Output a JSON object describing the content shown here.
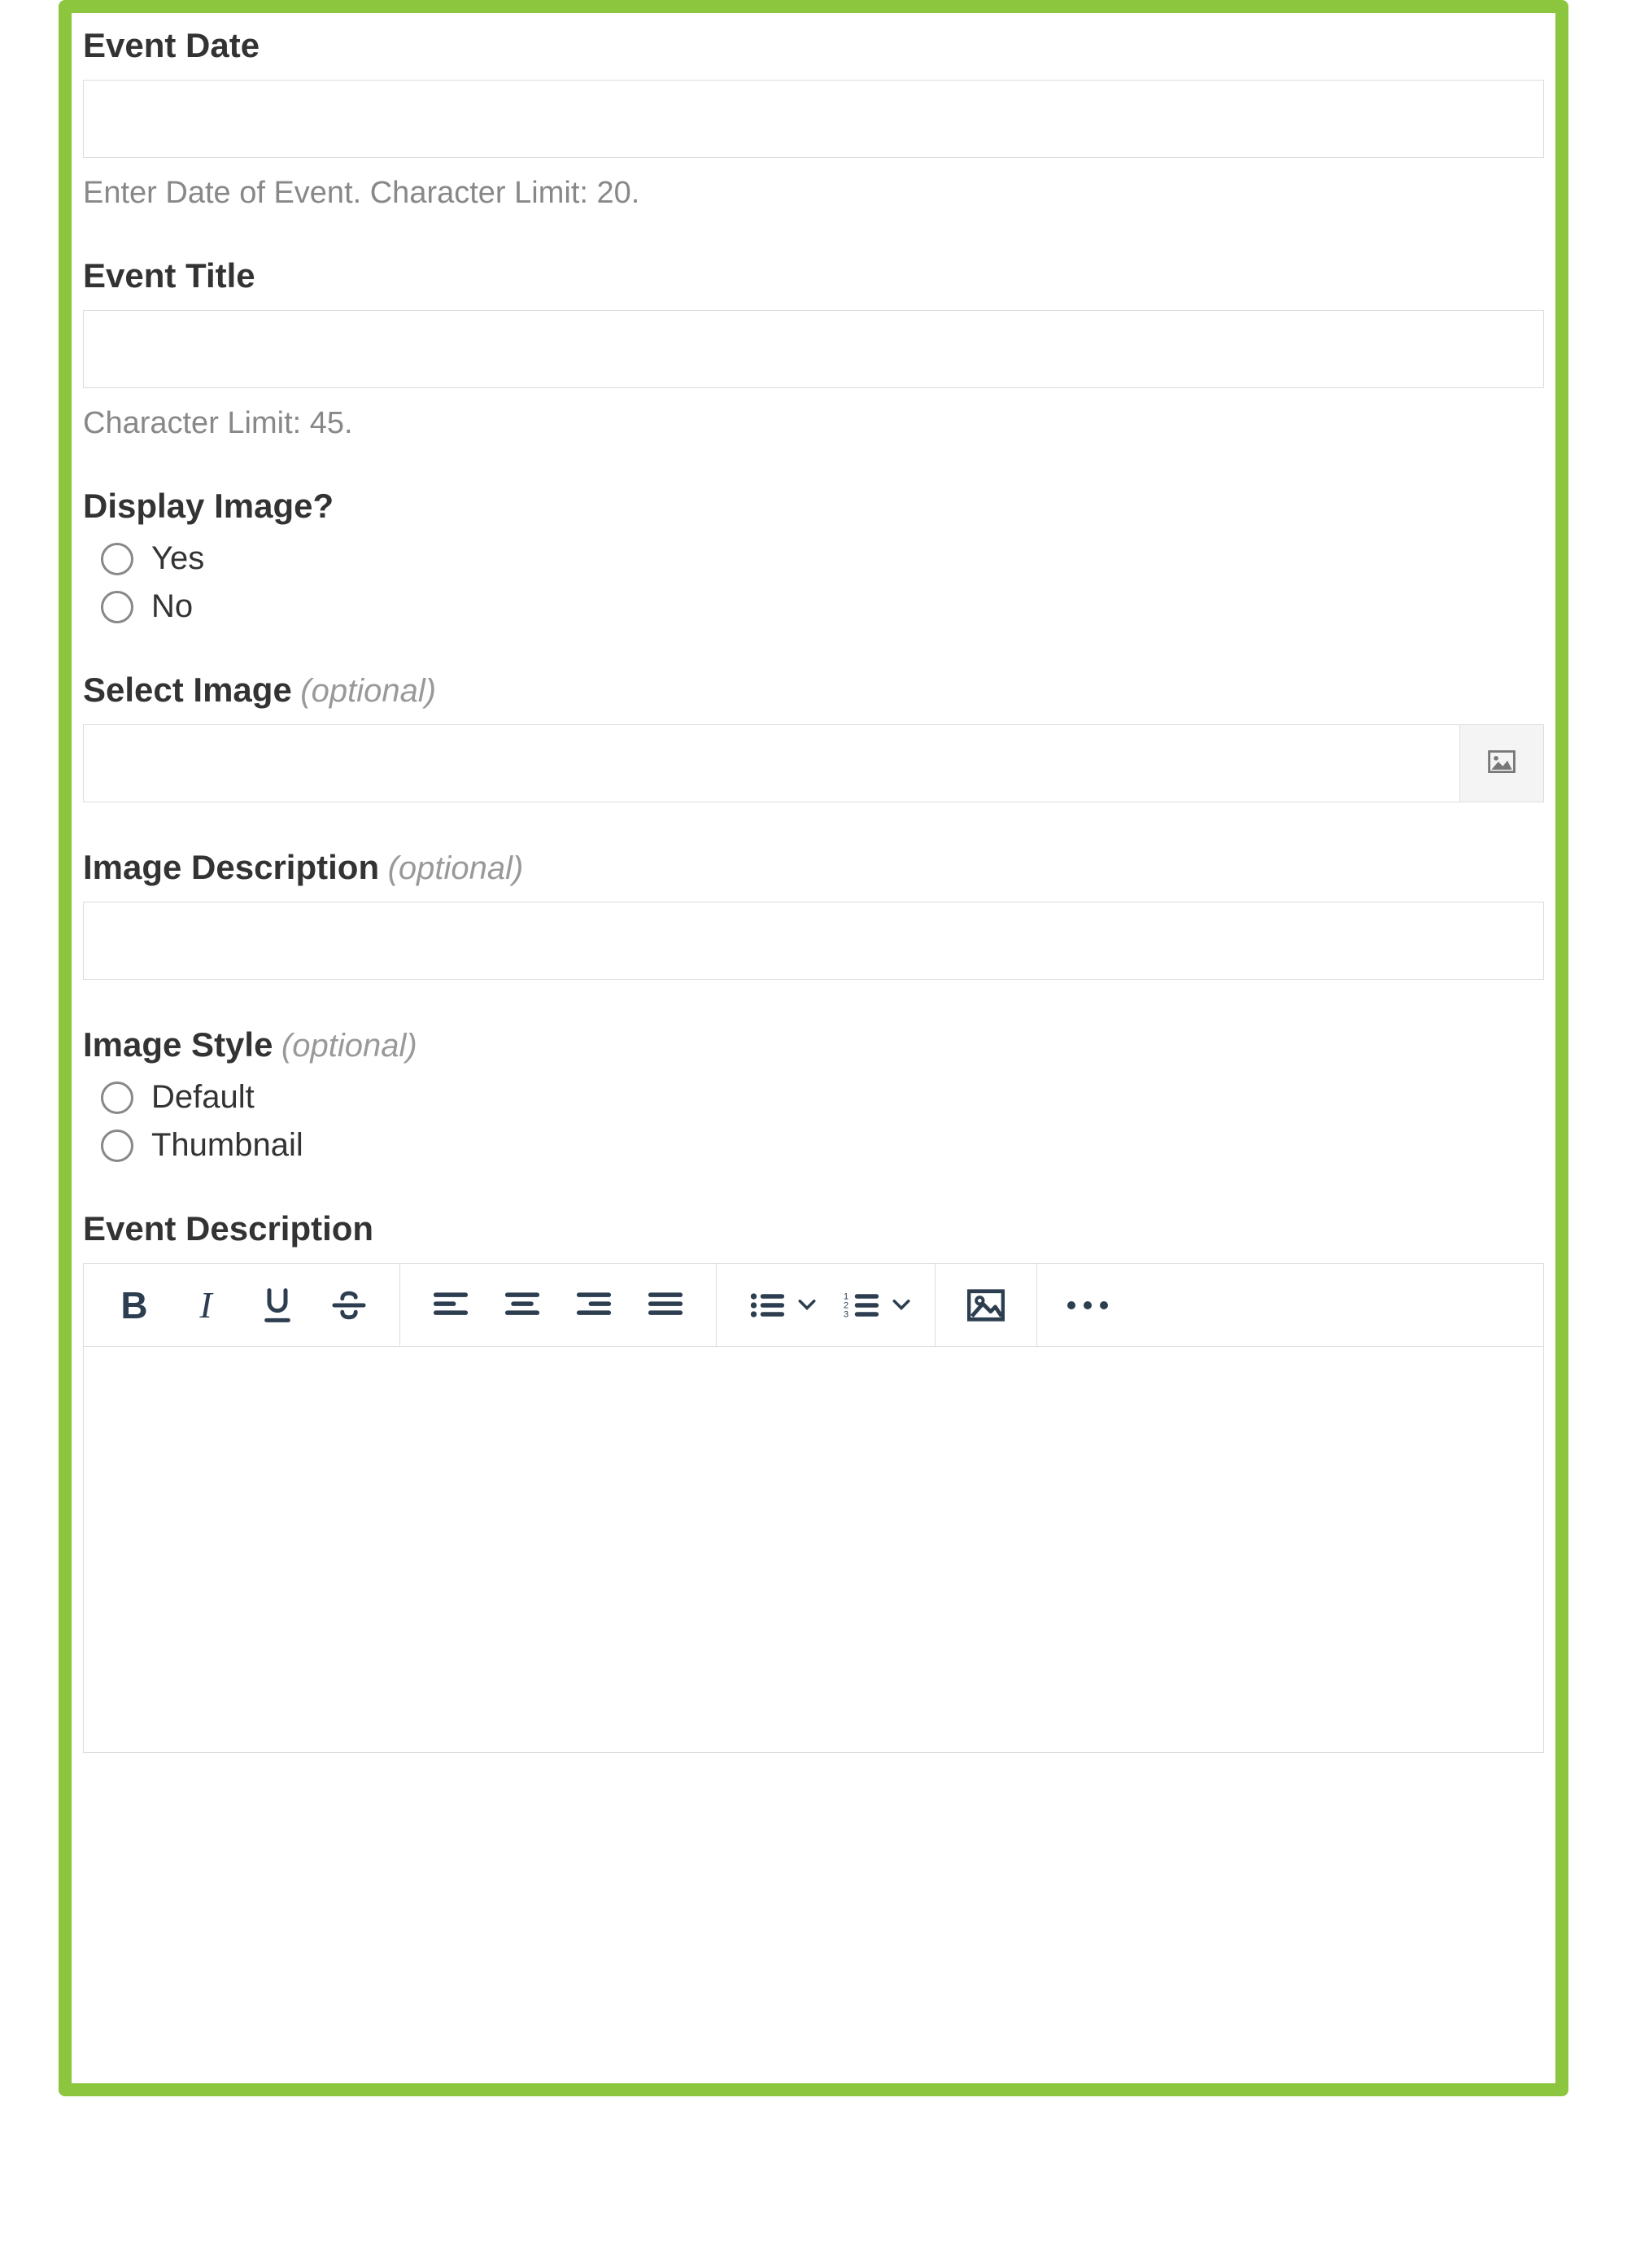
{
  "eventDate": {
    "label": "Event Date",
    "value": "",
    "helper": "Enter Date of Event. Character Limit: 20."
  },
  "eventTitle": {
    "label": "Event Title",
    "value": "",
    "helper": "Character Limit: 45."
  },
  "displayImage": {
    "label": "Display Image?",
    "options": [
      {
        "label": "Yes",
        "checked": false
      },
      {
        "label": "No",
        "checked": false
      }
    ]
  },
  "selectImage": {
    "label": "Select Image",
    "optional": "(optional)",
    "value": ""
  },
  "imageDescription": {
    "label": "Image Description",
    "optional": "(optional)",
    "value": ""
  },
  "imageStyle": {
    "label": "Image Style",
    "optional": "(optional)",
    "options": [
      {
        "label": "Default",
        "checked": false
      },
      {
        "label": "Thumbnail",
        "checked": false
      }
    ]
  },
  "eventDescription": {
    "label": "Event Description",
    "value": ""
  },
  "toolbar": {
    "icons": {
      "bold": "bold-icon",
      "italic": "italic-icon",
      "underline": "underline-icon",
      "strike": "strike-icon",
      "alignLeft": "align-left-icon",
      "alignCenter": "align-center-icon",
      "alignRight": "align-right-icon",
      "alignJustify": "align-justify-icon",
      "ulist": "bullet-list-icon",
      "olist": "numbered-list-icon",
      "image": "image-icon",
      "more": "more-options-icon"
    }
  }
}
